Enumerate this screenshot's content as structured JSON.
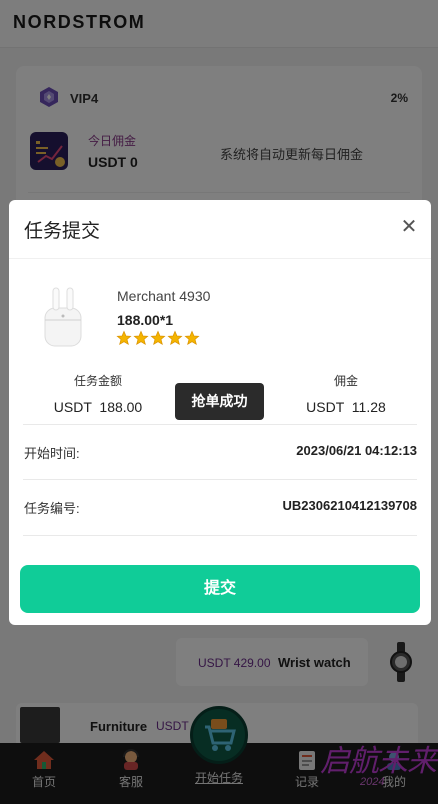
{
  "app": {
    "brand": "NORDSTROM"
  },
  "vip": {
    "level_label": "VIP4",
    "percent": "2%",
    "today_label": "今日佣金",
    "today_value": "USDT 0",
    "auto_update_note": "系统将自动更新每日佣金"
  },
  "list_items": [
    {
      "price": "USDT 429.00",
      "name": "Wrist watch"
    },
    {
      "name": "Furniture",
      "price": "USDT"
    }
  ],
  "tabbar": {
    "items": [
      {
        "label": "首页",
        "icon": "home-icon"
      },
      {
        "label": "客服",
        "icon": "support-agent-icon"
      },
      {
        "label": "开始任务",
        "icon": "shopping-cart-icon"
      },
      {
        "label": "记录",
        "icon": "records-icon"
      },
      {
        "label": "我的",
        "icon": "profile-icon"
      }
    ]
  },
  "watermark": {
    "text": "启航未来",
    "sub": "2024"
  },
  "modal": {
    "title": "任务提交",
    "close_icon": "close-icon",
    "product": {
      "merchant": "Merchant 4930",
      "price_qty": "188.00*1",
      "rating": 5,
      "image": "airpods-icon"
    },
    "task_amount_label": "任务金额",
    "task_amount_value": "USDT  188.00",
    "commission_label": "佣金",
    "commission_value": "USDT  11.28",
    "toast": "抢单成功",
    "start_time_label": "开始时间:",
    "start_time_value": "2023/06/21 04:12:13",
    "task_no_label": "任务编号:",
    "task_no_value": "UB2306210412139708",
    "submit_label": "提交"
  },
  "colors": {
    "accent": "#10cc98",
    "star": "#f4b400",
    "price_purple": "#6b2c8a",
    "watermark": "#c33fd8"
  }
}
